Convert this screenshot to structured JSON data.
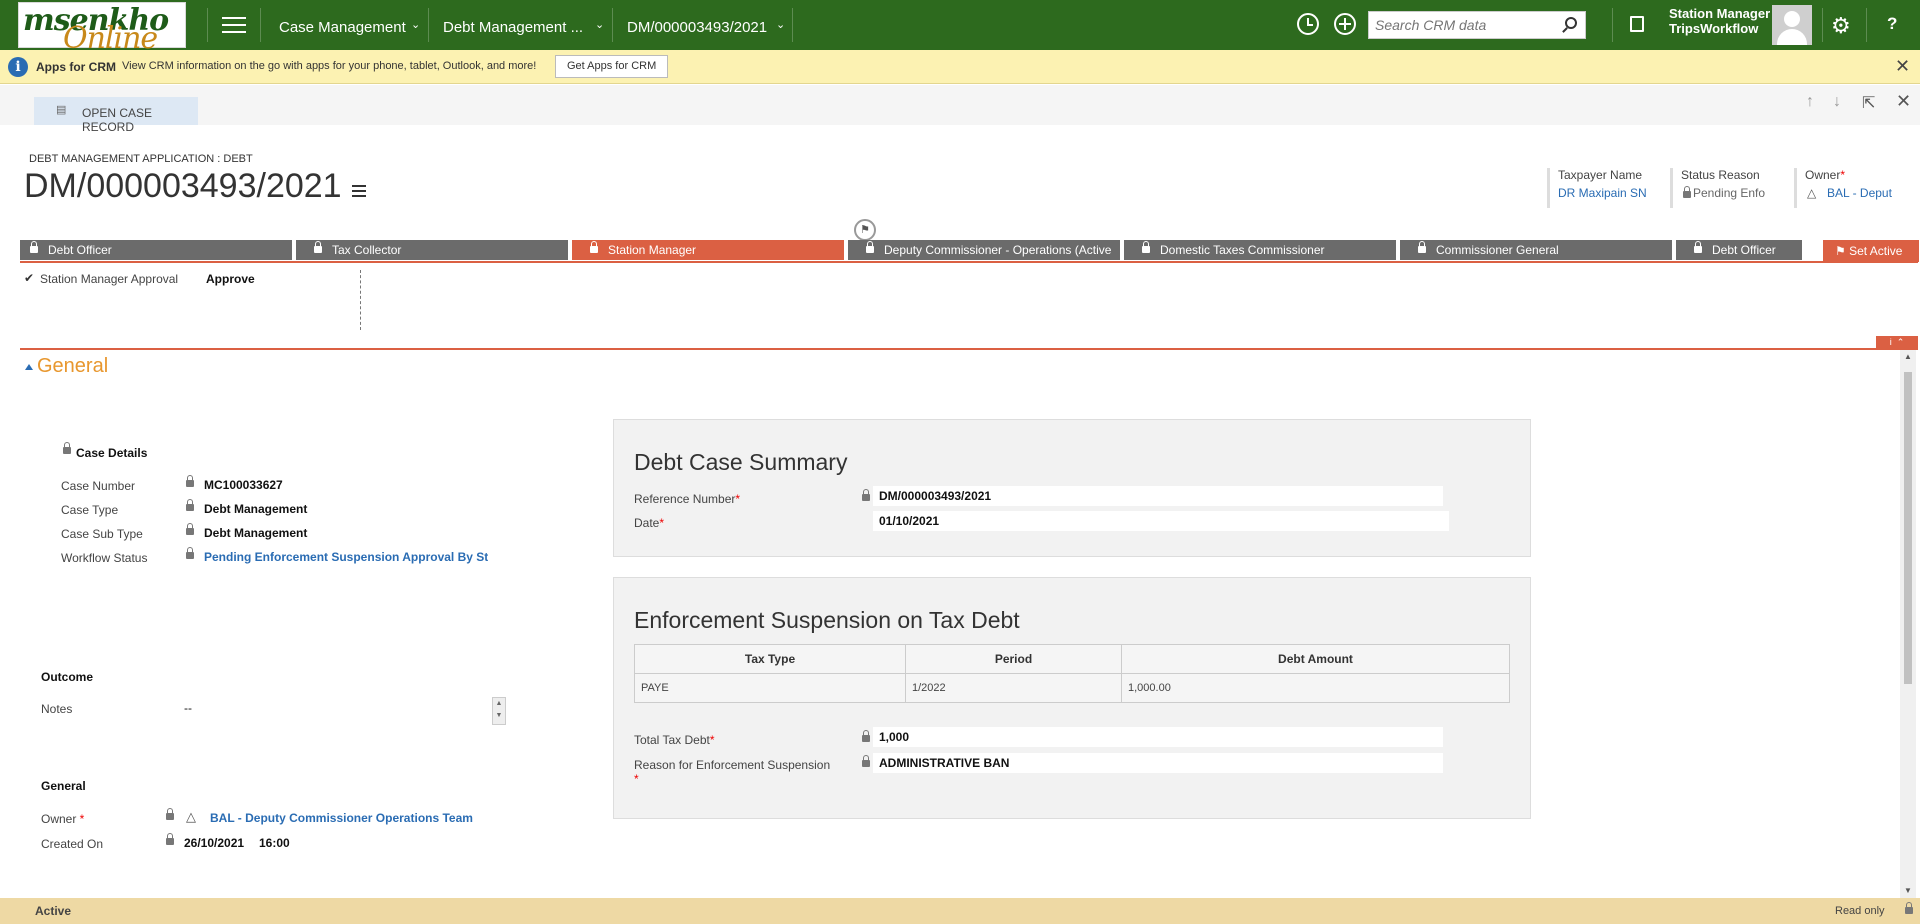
{
  "nav": {
    "logo_line1": "msenkho",
    "logo_line2": "Online",
    "area": "Case Management",
    "entity": "Debt Management ...",
    "record": "DM/000003493/2021",
    "search_placeholder": "Search CRM data",
    "user_role": "Station Manager",
    "user_org": "TripsWorkflow",
    "help": "?"
  },
  "infobar": {
    "title": "Apps for CRM",
    "message": "View CRM information on the go with apps for your phone, tablet, Outlook, and more!",
    "button": "Get Apps for CRM",
    "icon_char": "i",
    "close": "✕"
  },
  "command": {
    "open_case": "OPEN CASE RECORD"
  },
  "header": {
    "breadcrumb": "DEBT MANAGEMENT APPLICATION : DEBT",
    "title": "DM/000003493/2021",
    "fields": [
      {
        "label": "Taxpayer Name",
        "value": "DR Maxipain SN"
      },
      {
        "label": "Status Reason",
        "value": "Pending Enfo"
      },
      {
        "label": "Owner",
        "value": "BAL - Deput"
      }
    ]
  },
  "stages": [
    {
      "label": "Debt Officer"
    },
    {
      "label": "Tax Collector"
    },
    {
      "label": "Station Manager"
    },
    {
      "label": "Deputy Commissioner - Operations (Active"
    },
    {
      "label": "Domestic Taxes Commissioner"
    },
    {
      "label": "Commissioner General"
    },
    {
      "label": "Debt Officer"
    }
  ],
  "set_active": "Set Active",
  "approval": {
    "label": "Station Manager Approval",
    "value": "Approve"
  },
  "section_title": "General",
  "case_details": {
    "header": "Case Details",
    "rows": [
      {
        "label": "Case Number",
        "value": "MC100033627"
      },
      {
        "label": "Case Type",
        "value": "Debt Management"
      },
      {
        "label": "Case Sub Type",
        "value": "Debt Management"
      },
      {
        "label": "Workflow Status",
        "value": "Pending Enforcement Suspension Approval By St"
      }
    ]
  },
  "outcome": {
    "header": "Outcome",
    "notes_label": "Notes",
    "notes_value": "--"
  },
  "general": {
    "header": "General",
    "owner_label": "Owner",
    "owner_value": "BAL - Deputy Commissioner Operations Team",
    "created_label": "Created On",
    "created_date": "26/10/2021",
    "created_time": "16:00"
  },
  "summary": {
    "title": "Debt Case Summary",
    "ref_label": "Reference Number",
    "ref_value": "DM/000003493/2021",
    "date_label": "Date",
    "date_value": "01/10/2021"
  },
  "enforcement": {
    "title": "Enforcement Suspension on Tax Debt",
    "columns": [
      "Tax Type",
      "Period",
      "Debt Amount"
    ],
    "rows": [
      [
        "PAYE",
        "1/2022",
        "1,000.00"
      ]
    ],
    "total_label": "Total Tax Debt",
    "total_value": "1,000",
    "reason_label": "Reason for Enforcement Suspension",
    "reason_value": "ADMINISTRATIVE BAN"
  },
  "footer": {
    "status": "Active",
    "mode": "Read only"
  }
}
